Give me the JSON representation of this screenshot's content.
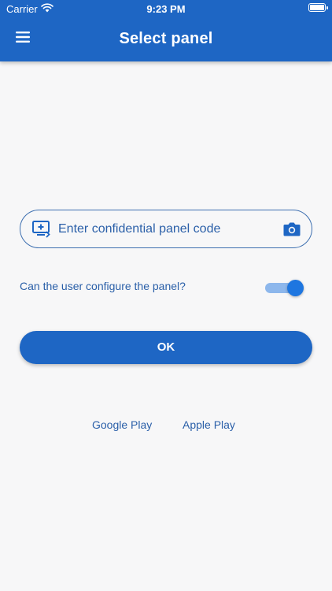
{
  "status_bar": {
    "carrier": "Carrier",
    "time": "9:23 PM",
    "battery_level": 1.0
  },
  "header": {
    "title": "Select panel",
    "menu_icon": "hamburger-menu-icon",
    "background": "#1e66c4"
  },
  "code_input": {
    "placeholder": "Enter confidential panel code",
    "value": "",
    "left_icon": "add-screen-icon",
    "right_icon": "camera-icon"
  },
  "config": {
    "label": "Can the user configure the panel?",
    "toggle_on": true
  },
  "ok_button": {
    "label": "OK"
  },
  "store_links": {
    "google": "Google Play",
    "apple": "Apple Play"
  },
  "colors": {
    "accent": "#1e66c4",
    "text_accent": "#2a5fa8",
    "background": "#f7f7f8",
    "toggle_track": "#8db7ec",
    "toggle_knob": "#1e76e0"
  }
}
